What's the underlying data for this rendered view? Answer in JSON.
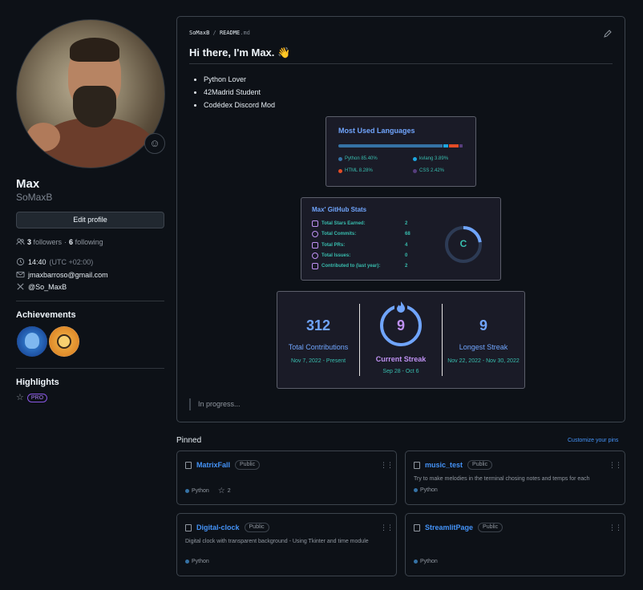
{
  "profile": {
    "name": "Max",
    "login": "SoMaxB",
    "edit_label": "Edit profile",
    "followers_count": "3",
    "followers_label": "followers",
    "following_count": "6",
    "following_label": "following",
    "time": "14:40",
    "timezone": "(UTC +02:00)",
    "email": "jmaxbarroso@gmail.com",
    "x_handle": "@So_MaxB"
  },
  "achievements": {
    "title": "Achievements"
  },
  "highlights": {
    "title": "Highlights",
    "pro_label": "PRO"
  },
  "readme": {
    "owner": "SoMaxB",
    "separator": "/",
    "file": "README",
    "ext": ".md",
    "heading": "Hi there, I'm Max. 👋",
    "bullets": [
      "Python Lover",
      "42Madrid Student",
      "Codédex Discord Mod"
    ],
    "in_progress": "In progress..."
  },
  "languages_card": {
    "title": "Most Used Languages",
    "items": [
      {
        "label": "Python 85.40%",
        "color": "#3572A5",
        "percent": 85.4
      },
      {
        "label": "kvlang 3.89%",
        "color": "#1da6e0",
        "percent": 3.89
      },
      {
        "label": "HTML 8.28%",
        "color": "#e34c26",
        "percent": 8.28
      },
      {
        "label": "CSS 2.42%",
        "color": "#563d7c",
        "percent": 2.42
      }
    ]
  },
  "stats_card": {
    "title": "Max' GitHub Stats",
    "rows": [
      {
        "label": "Total Stars Earned:",
        "value": "2"
      },
      {
        "label": "Total Commits:",
        "value": "68"
      },
      {
        "label": "Total PRs:",
        "value": "4"
      },
      {
        "label": "Total Issues:",
        "value": "0"
      },
      {
        "label": "Contributed to (last year):",
        "value": "2"
      }
    ],
    "rank": "C"
  },
  "streak_card": {
    "total_value": "312",
    "total_label": "Total Contributions",
    "total_range": "Nov 7, 2022 - Present",
    "current_value": "9",
    "current_label": "Current Streak",
    "current_range": "Sep 28 - Oct 6",
    "longest_value": "9",
    "longest_label": "Longest Streak",
    "longest_range": "Nov 22, 2022 - Nov 30, 2022"
  },
  "pinned": {
    "title": "Pinned",
    "customize_label": "Customize your pins",
    "repos": [
      {
        "name": "MatrixFall",
        "visibility": "Public",
        "description": "",
        "language": "Python",
        "stars": "2"
      },
      {
        "name": "music_test",
        "visibility": "Public",
        "description": "Try to make melodies in the terminal chosing notes and temps for each",
        "language": "Python",
        "stars": ""
      },
      {
        "name": "Digital-clock",
        "visibility": "Public",
        "description": "Digital clock with transparent background - Using Tkinter and time module",
        "language": "Python",
        "stars": ""
      },
      {
        "name": "StreamlitPage",
        "visibility": "Public",
        "description": "",
        "language": "Python",
        "stars": ""
      }
    ],
    "language_color": "#3572A5"
  },
  "colors": {
    "accent": "#4493f8",
    "card_title": "#70a5fd",
    "card_text": "#38bdae",
    "card_icon": "#bf91f3",
    "streak_ring": "#70a5fd",
    "streak_fire": "#fb8c00"
  }
}
